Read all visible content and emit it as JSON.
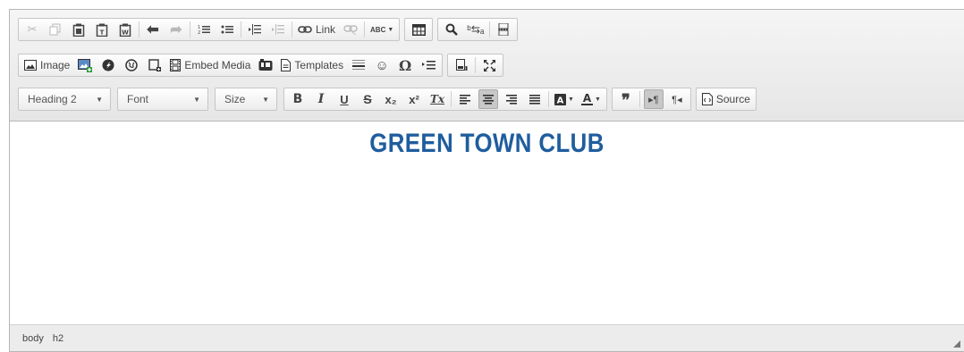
{
  "toolbar": {
    "row1": {
      "cut": "✂",
      "copy": "⎘",
      "paste": "📋",
      "undo": "↶",
      "redo": "↷",
      "link_label": "Link",
      "spell": "ABC"
    },
    "row2": {
      "image_label": "Image",
      "embed_label": "Embed Media",
      "templates_label": "Templates",
      "omega": "Ω"
    },
    "row3": {
      "format_value": "Heading 2",
      "font_value": "Font",
      "size_value": "Size",
      "bold": "B",
      "italic": "I",
      "underline": "U",
      "strike": "S",
      "sub": "x₂",
      "sup": "x²",
      "removeformat": "Tx",
      "source_label": "Source"
    }
  },
  "content": {
    "heading": "GREEN TOWN CLUB"
  },
  "statusbar": {
    "path": [
      "body",
      "h2"
    ]
  }
}
